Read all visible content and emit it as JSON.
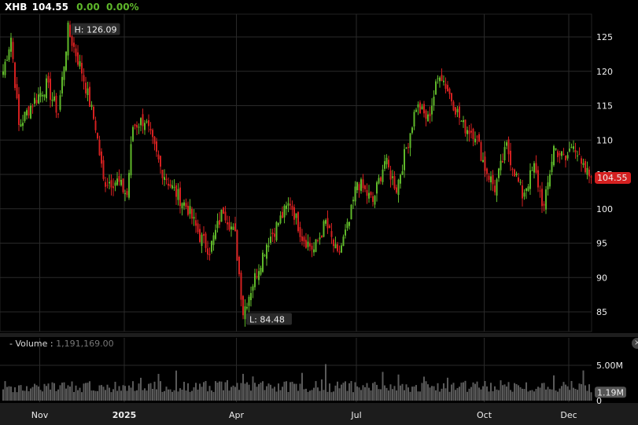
{
  "header": {
    "symbol": "XHB",
    "last": "104.55",
    "change": "0.00",
    "change_pct": "0.00%"
  },
  "volume_panel": {
    "label": "- Volume :",
    "value": "1,191,169.00",
    "close": "×"
  },
  "colors": {
    "up": "#5fb82a",
    "down": "#d42020",
    "volume": "#5a5a5a",
    "grid": "#2a2a2a",
    "last_price_bg": "#d42020"
  },
  "chart_data": {
    "type": "candlestick",
    "symbol": "XHB",
    "y_ticks": [
      85,
      90,
      95,
      100,
      105,
      110,
      115,
      120,
      125
    ],
    "ylim": [
      82.5,
      128.5
    ],
    "x_labels": [
      {
        "label": "Nov",
        "day": 19,
        "bold": false
      },
      {
        "label": "2025",
        "day": 62,
        "bold": true
      },
      {
        "label": "Apr",
        "day": 119,
        "bold": false
      },
      {
        "label": "Jul",
        "day": 180,
        "bold": false
      },
      {
        "label": "Oct",
        "day": 245,
        "bold": false
      },
      {
        "label": "Dec",
        "day": 288,
        "bold": false
      }
    ],
    "n_days": 300,
    "close_path": [
      [
        0,
        120
      ],
      [
        4,
        125
      ],
      [
        8,
        112
      ],
      [
        14,
        115
      ],
      [
        22,
        118
      ],
      [
        28,
        114
      ],
      [
        33,
        126
      ],
      [
        40,
        120
      ],
      [
        47,
        112
      ],
      [
        51,
        104
      ],
      [
        58,
        104
      ],
      [
        63,
        102
      ],
      [
        66,
        112
      ],
      [
        72,
        113
      ],
      [
        80,
        106
      ],
      [
        86,
        103
      ],
      [
        94,
        100
      ],
      [
        100,
        96
      ],
      [
        105,
        94
      ],
      [
        112,
        100
      ],
      [
        118,
        96
      ],
      [
        122,
        85
      ],
      [
        128,
        90
      ],
      [
        134,
        95
      ],
      [
        140,
        98
      ],
      [
        146,
        101
      ],
      [
        152,
        96
      ],
      [
        158,
        94
      ],
      [
        164,
        98
      ],
      [
        170,
        93
      ],
      [
        176,
        98
      ],
      [
        180,
        104
      ],
      [
        188,
        101
      ],
      [
        194,
        107
      ],
      [
        200,
        103
      ],
      [
        206,
        110
      ],
      [
        210,
        115
      ],
      [
        216,
        113
      ],
      [
        222,
        120
      ],
      [
        228,
        116
      ],
      [
        234,
        112
      ],
      [
        240,
        111
      ],
      [
        245,
        106
      ],
      [
        250,
        103
      ],
      [
        256,
        109
      ],
      [
        264,
        102
      ],
      [
        270,
        106
      ],
      [
        275,
        100
      ],
      [
        280,
        109
      ],
      [
        286,
        107
      ],
      [
        290,
        110
      ],
      [
        294,
        106
      ],
      [
        299,
        104.55
      ]
    ],
    "high": {
      "label": "H: 126.09",
      "value": 126.09,
      "day": 33
    },
    "low": {
      "label": "L: 84.48",
      "value": 84.48,
      "day": 122
    },
    "last_price": {
      "label": "104.55",
      "value": 104.55
    },
    "volume": {
      "y_ticks": [
        {
          "label": "5.00M",
          "value": 5
        },
        {
          "label": "0",
          "value": 0
        }
      ],
      "last": {
        "label": "1.19M",
        "value": 1.19
      },
      "unit": "M"
    }
  }
}
